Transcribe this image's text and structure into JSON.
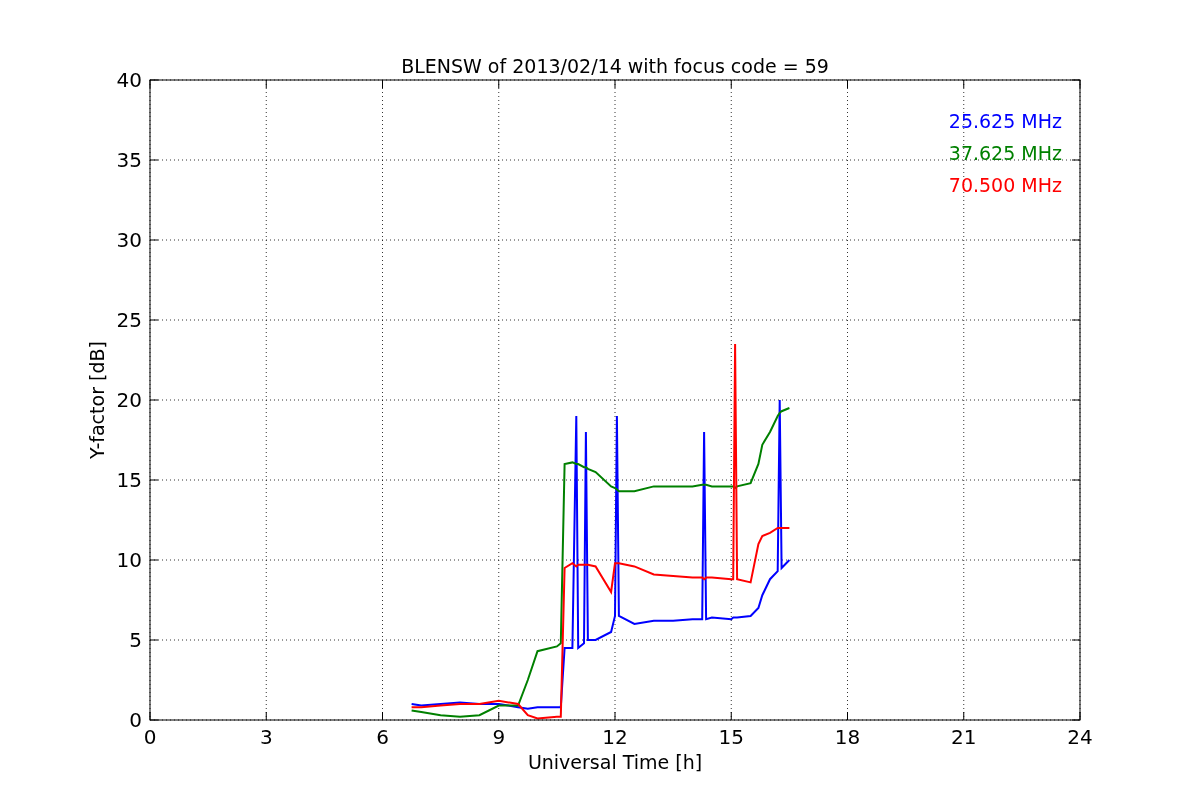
{
  "figure": {
    "chart_data": {
      "type": "line",
      "title": "BLENSW of 2013/02/14 with focus code = 59",
      "xlabel": "Universal Time [h]",
      "ylabel": "Y-factor [dB]",
      "x": [
        6.75,
        7,
        7.5,
        8,
        8.5,
        9,
        9.5,
        9.75,
        10,
        10.5,
        10.6,
        10.7,
        10.9,
        11,
        11.05,
        11.2,
        11.25,
        11.3,
        11.5,
        11.9,
        12,
        12.05,
        12.1,
        12.5,
        13,
        13.5,
        14,
        14.25,
        14.3,
        14.35,
        14.5,
        15,
        15.05,
        15.1,
        15.15,
        15.5,
        15.7,
        15.8,
        16,
        16.2,
        16.25,
        16.3,
        16.5
      ],
      "series": [
        {
          "name": "25.625 MHz",
          "color": "#0000ff",
          "values": [
            1,
            0.9,
            1,
            1.1,
            1,
            1,
            0.8,
            0.7,
            0.8,
            0.8,
            0.8,
            4.5,
            4.5,
            19,
            4.5,
            4.8,
            18,
            5,
            5,
            5.5,
            6.5,
            19,
            6.5,
            6,
            6.2,
            6.2,
            6.3,
            6.3,
            18,
            6.3,
            6.4,
            6.3,
            6.4,
            6.4,
            6.4,
            6.5,
            7,
            7.8,
            8.8,
            9.3,
            20,
            9.5,
            10
          ]
        },
        {
          "name": "37.625 MHz",
          "color": "#008000",
          "values": [
            0.6,
            0.5,
            0.3,
            0.2,
            0.3,
            0.9,
            0.9,
            2.5,
            4.3,
            4.6,
            4.8,
            16,
            16.1,
            16,
            16,
            15.8,
            15.8,
            15.7,
            15.5,
            14.6,
            14.5,
            14.4,
            14.3,
            14.3,
            14.6,
            14.6,
            14.6,
            14.7,
            14.7,
            14.7,
            14.6,
            14.6,
            14.6,
            14.5,
            14.6,
            14.8,
            16,
            17.2,
            18,
            19,
            19.2,
            19.3,
            19.5
          ]
        },
        {
          "name": "70.500 MHz",
          "color": "#ff0000",
          "values": [
            0.8,
            0.8,
            0.9,
            1,
            1,
            1.2,
            1,
            0.3,
            0.1,
            0.2,
            0.2,
            9.5,
            9.8,
            9.6,
            9.7,
            9.7,
            9.7,
            9.7,
            9.6,
            8,
            9.8,
            9.8,
            9.8,
            9.6,
            9.1,
            9,
            8.9,
            8.9,
            8.8,
            8.9,
            8.9,
            8.8,
            8.8,
            23.5,
            8.8,
            8.6,
            11,
            11.5,
            11.7,
            12,
            12,
            12,
            12
          ]
        }
      ],
      "xlim": [
        0,
        24
      ],
      "ylim": [
        0,
        40
      ],
      "xticks": [
        0,
        3,
        6,
        9,
        12,
        15,
        18,
        21,
        24
      ],
      "yticks": [
        0,
        5,
        10,
        15,
        20,
        25,
        30,
        35,
        40
      ],
      "grid": true
    }
  }
}
